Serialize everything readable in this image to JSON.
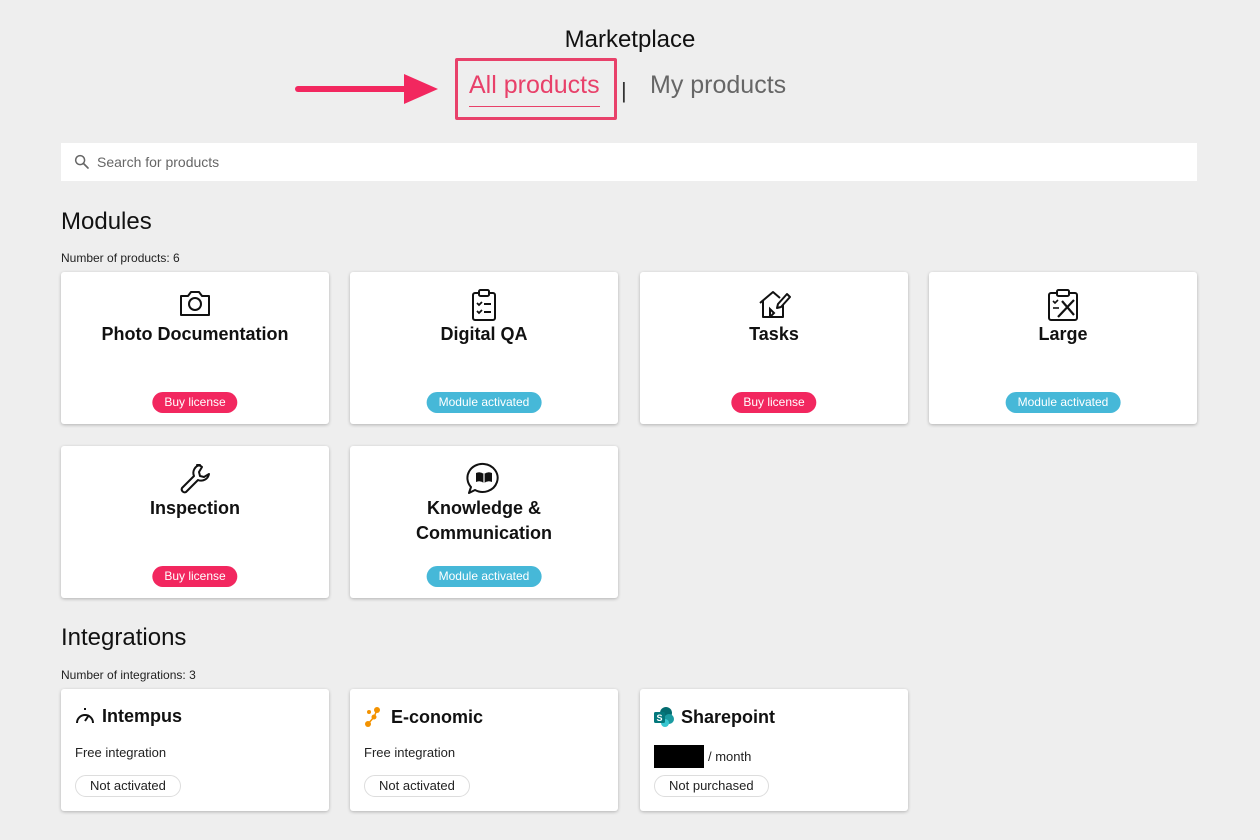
{
  "header": {
    "title": "Marketplace",
    "tabs": {
      "all": "All products",
      "separator": "|",
      "my": "My products"
    }
  },
  "search": {
    "placeholder": "Search for products",
    "value": ""
  },
  "modules": {
    "title": "Modules",
    "count_label": "Number of products: 6",
    "items": [
      {
        "name": "Photo Documentation",
        "icon": "camera-icon",
        "badge": "Buy license",
        "badge_color": "#f2275f"
      },
      {
        "name": "Digital QA",
        "icon": "clipboard-checklist-icon",
        "badge": "Module activated",
        "badge_color": "#46b8d8"
      },
      {
        "name": "Tasks",
        "icon": "house-pen-icon",
        "badge": "Buy license",
        "badge_color": "#f2275f"
      },
      {
        "name": "Large",
        "icon": "clipboard-tools-icon",
        "badge": "Module activated",
        "badge_color": "#46b8d8"
      },
      {
        "name": "Inspection",
        "icon": "wrench-icon",
        "badge": "Buy license",
        "badge_color": "#f2275f"
      },
      {
        "name": "Knowledge & Communication",
        "icon": "book-chat-icon",
        "badge": "Module activated",
        "badge_color": "#46b8d8"
      }
    ]
  },
  "integrations": {
    "title": "Integrations",
    "count_label": "Number of integrations: 3",
    "items": [
      {
        "name": "Intempus",
        "icon": "stopwatch-icon",
        "price": "Free integration",
        "status": "Not activated"
      },
      {
        "name": "E-conomic",
        "icon": "e-conomic-logo-icon",
        "price": "Free integration",
        "status": "Not activated"
      },
      {
        "name": "Sharepoint",
        "icon": "sharepoint-logo-icon",
        "price": "/ month",
        "status": "Not purchased"
      }
    ]
  },
  "colors": {
    "accent": "#e8416a",
    "buy": "#f2275f",
    "activated": "#46b8d8",
    "background": "#eeeeee"
  }
}
